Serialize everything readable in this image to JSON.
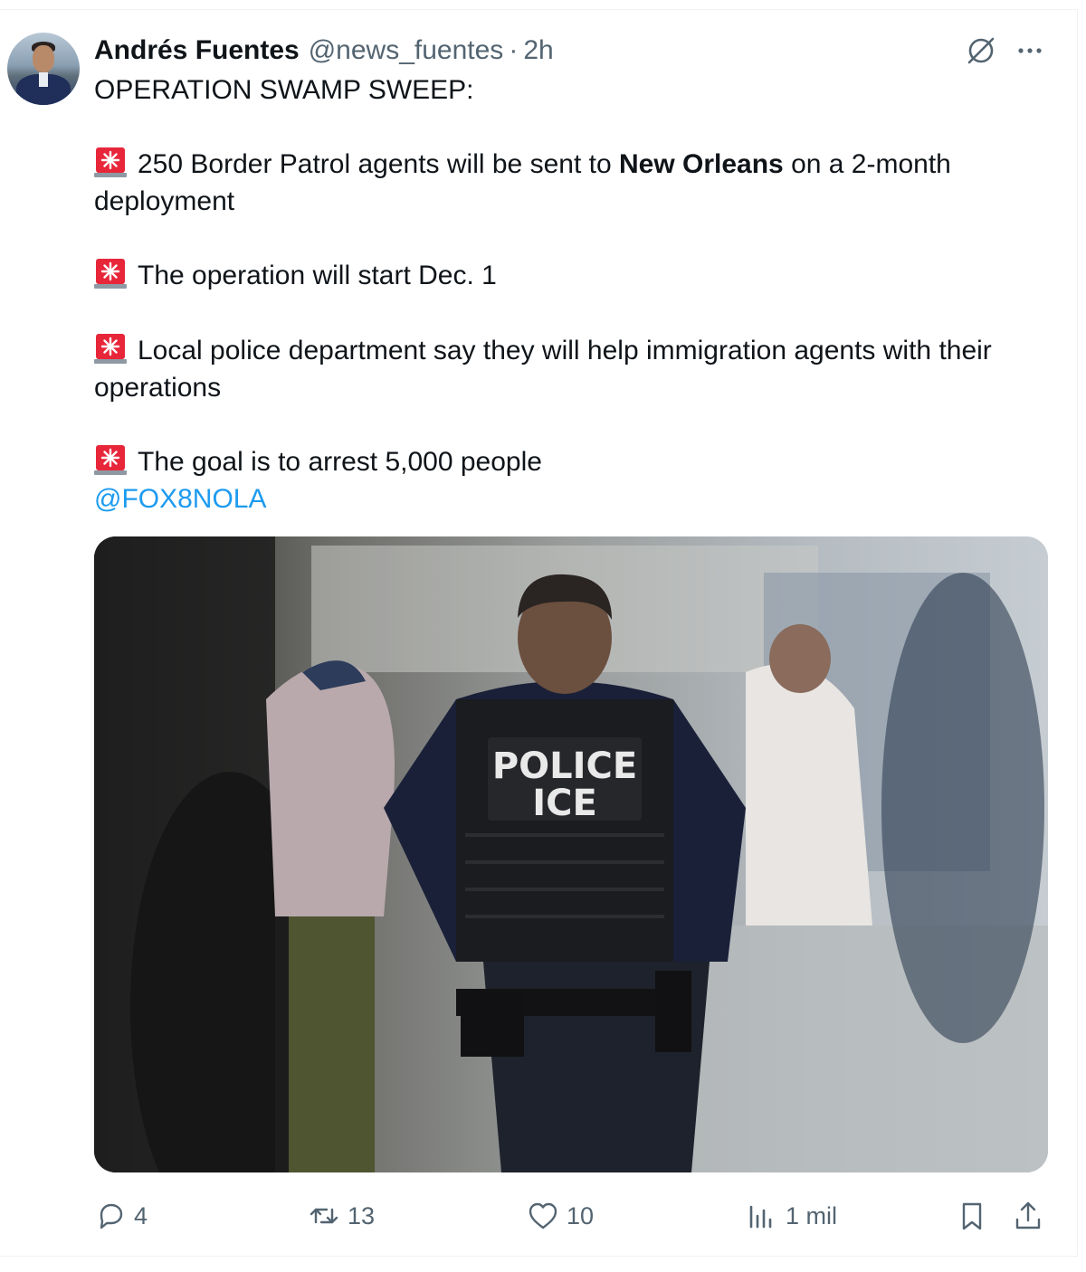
{
  "tweet": {
    "author_name": "Andrés Fuentes",
    "handle": "@news_fuentes",
    "separator": "·",
    "time": "2h",
    "lines": {
      "headline": "OPERATION SWAMP SWEEP:",
      "item1_pre": "250 Border Patrol agents will be sent to ",
      "item1_bold": "New Orleans",
      "item1_post": " on a 2-month deployment",
      "item2": "The operation will start Dec. 1",
      "item3": "Local police department say they will help immigration agents with their operations",
      "item4": "The goal is to arrest 5,000 people",
      "mention": "@FOX8NOLA"
    },
    "media": {
      "vest_line1": "POLICE",
      "vest_line2": "ICE"
    },
    "stats": {
      "replies": "4",
      "reposts": "13",
      "likes": "10",
      "views": "1 mil"
    }
  },
  "icons": {
    "bullet": "rotating-light-emoji",
    "grok": "grok-slash-icon",
    "more": "more-dots-icon",
    "reply": "reply-icon",
    "repost": "repost-icon",
    "like": "heart-icon",
    "views": "views-icon",
    "bookmark": "bookmark-icon",
    "share": "share-icon"
  },
  "colors": {
    "text": "#0f1419",
    "muted": "#536471",
    "link": "#1d9bf0",
    "siren": "#e8263a"
  }
}
